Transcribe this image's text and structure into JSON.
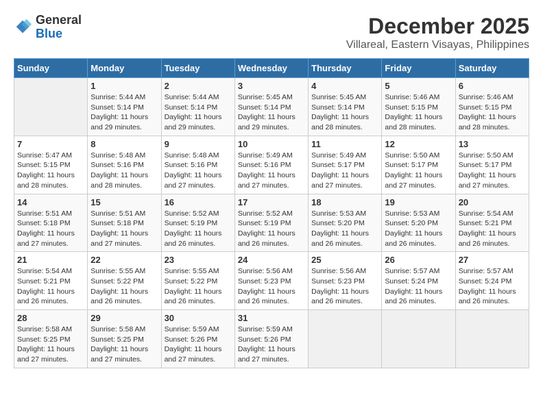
{
  "logo": {
    "general": "General",
    "blue": "Blue"
  },
  "title": "December 2025",
  "subtitle": "Villareal, Eastern Visayas, Philippines",
  "days_header": [
    "Sunday",
    "Monday",
    "Tuesday",
    "Wednesday",
    "Thursday",
    "Friday",
    "Saturday"
  ],
  "weeks": [
    [
      {
        "day": "",
        "sunrise": "",
        "sunset": "",
        "daylight": ""
      },
      {
        "day": "1",
        "sunrise": "5:44 AM",
        "sunset": "5:14 PM",
        "daylight": "11 hours and 29 minutes."
      },
      {
        "day": "2",
        "sunrise": "5:44 AM",
        "sunset": "5:14 PM",
        "daylight": "11 hours and 29 minutes."
      },
      {
        "day": "3",
        "sunrise": "5:45 AM",
        "sunset": "5:14 PM",
        "daylight": "11 hours and 29 minutes."
      },
      {
        "day": "4",
        "sunrise": "5:45 AM",
        "sunset": "5:14 PM",
        "daylight": "11 hours and 28 minutes."
      },
      {
        "day": "5",
        "sunrise": "5:46 AM",
        "sunset": "5:15 PM",
        "daylight": "11 hours and 28 minutes."
      },
      {
        "day": "6",
        "sunrise": "5:46 AM",
        "sunset": "5:15 PM",
        "daylight": "11 hours and 28 minutes."
      }
    ],
    [
      {
        "day": "7",
        "sunrise": "5:47 AM",
        "sunset": "5:15 PM",
        "daylight": "11 hours and 28 minutes."
      },
      {
        "day": "8",
        "sunrise": "5:48 AM",
        "sunset": "5:16 PM",
        "daylight": "11 hours and 28 minutes."
      },
      {
        "day": "9",
        "sunrise": "5:48 AM",
        "sunset": "5:16 PM",
        "daylight": "11 hours and 27 minutes."
      },
      {
        "day": "10",
        "sunrise": "5:49 AM",
        "sunset": "5:16 PM",
        "daylight": "11 hours and 27 minutes."
      },
      {
        "day": "11",
        "sunrise": "5:49 AM",
        "sunset": "5:17 PM",
        "daylight": "11 hours and 27 minutes."
      },
      {
        "day": "12",
        "sunrise": "5:50 AM",
        "sunset": "5:17 PM",
        "daylight": "11 hours and 27 minutes."
      },
      {
        "day": "13",
        "sunrise": "5:50 AM",
        "sunset": "5:17 PM",
        "daylight": "11 hours and 27 minutes."
      }
    ],
    [
      {
        "day": "14",
        "sunrise": "5:51 AM",
        "sunset": "5:18 PM",
        "daylight": "11 hours and 27 minutes."
      },
      {
        "day": "15",
        "sunrise": "5:51 AM",
        "sunset": "5:18 PM",
        "daylight": "11 hours and 27 minutes."
      },
      {
        "day": "16",
        "sunrise": "5:52 AM",
        "sunset": "5:19 PM",
        "daylight": "11 hours and 26 minutes."
      },
      {
        "day": "17",
        "sunrise": "5:52 AM",
        "sunset": "5:19 PM",
        "daylight": "11 hours and 26 minutes."
      },
      {
        "day": "18",
        "sunrise": "5:53 AM",
        "sunset": "5:20 PM",
        "daylight": "11 hours and 26 minutes."
      },
      {
        "day": "19",
        "sunrise": "5:53 AM",
        "sunset": "5:20 PM",
        "daylight": "11 hours and 26 minutes."
      },
      {
        "day": "20",
        "sunrise": "5:54 AM",
        "sunset": "5:21 PM",
        "daylight": "11 hours and 26 minutes."
      }
    ],
    [
      {
        "day": "21",
        "sunrise": "5:54 AM",
        "sunset": "5:21 PM",
        "daylight": "11 hours and 26 minutes."
      },
      {
        "day": "22",
        "sunrise": "5:55 AM",
        "sunset": "5:22 PM",
        "daylight": "11 hours and 26 minutes."
      },
      {
        "day": "23",
        "sunrise": "5:55 AM",
        "sunset": "5:22 PM",
        "daylight": "11 hours and 26 minutes."
      },
      {
        "day": "24",
        "sunrise": "5:56 AM",
        "sunset": "5:23 PM",
        "daylight": "11 hours and 26 minutes."
      },
      {
        "day": "25",
        "sunrise": "5:56 AM",
        "sunset": "5:23 PM",
        "daylight": "11 hours and 26 minutes."
      },
      {
        "day": "26",
        "sunrise": "5:57 AM",
        "sunset": "5:24 PM",
        "daylight": "11 hours and 26 minutes."
      },
      {
        "day": "27",
        "sunrise": "5:57 AM",
        "sunset": "5:24 PM",
        "daylight": "11 hours and 26 minutes."
      }
    ],
    [
      {
        "day": "28",
        "sunrise": "5:58 AM",
        "sunset": "5:25 PM",
        "daylight": "11 hours and 27 minutes."
      },
      {
        "day": "29",
        "sunrise": "5:58 AM",
        "sunset": "5:25 PM",
        "daylight": "11 hours and 27 minutes."
      },
      {
        "day": "30",
        "sunrise": "5:59 AM",
        "sunset": "5:26 PM",
        "daylight": "11 hours and 27 minutes."
      },
      {
        "day": "31",
        "sunrise": "5:59 AM",
        "sunset": "5:26 PM",
        "daylight": "11 hours and 27 minutes."
      },
      {
        "day": "",
        "sunrise": "",
        "sunset": "",
        "daylight": ""
      },
      {
        "day": "",
        "sunrise": "",
        "sunset": "",
        "daylight": ""
      },
      {
        "day": "",
        "sunrise": "",
        "sunset": "",
        "daylight": ""
      }
    ]
  ]
}
